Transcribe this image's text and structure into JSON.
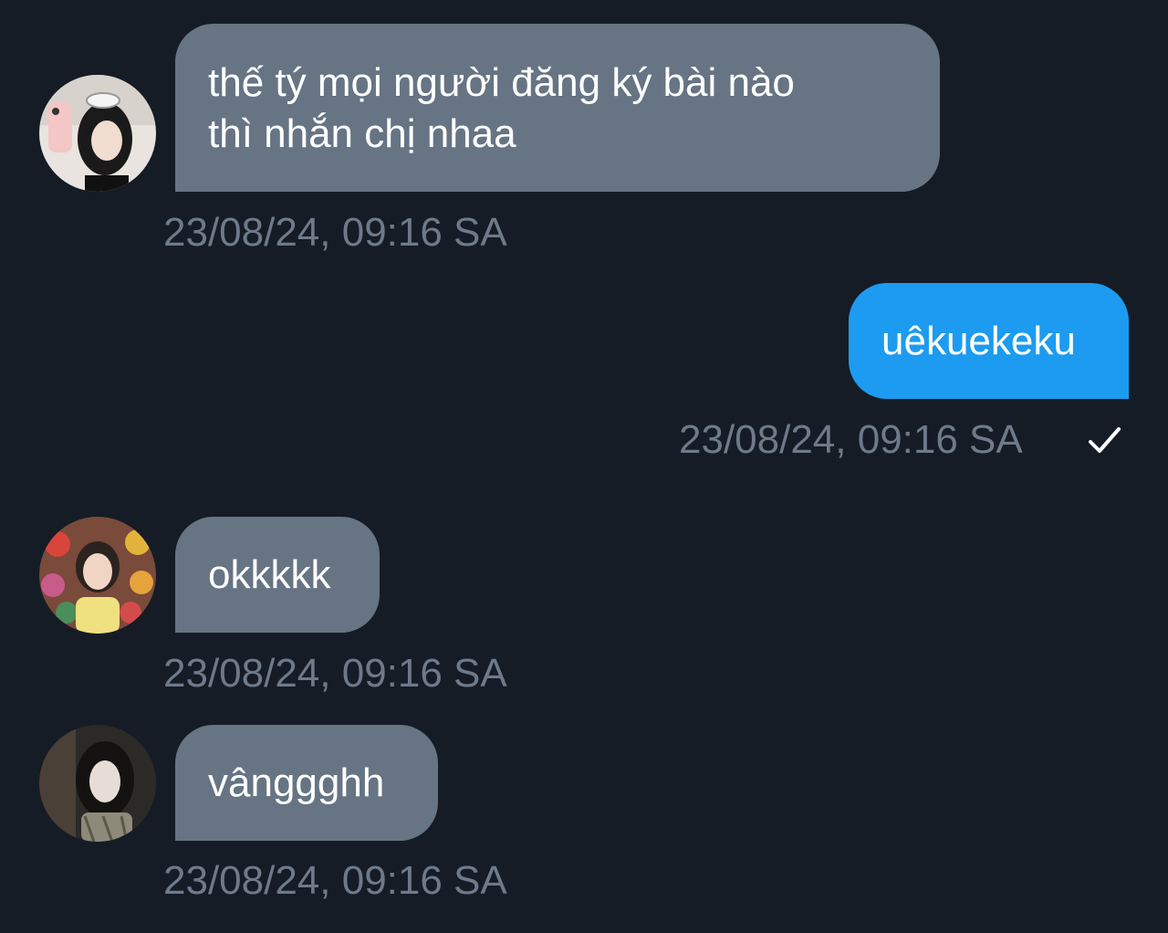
{
  "messages": [
    {
      "direction": "incoming",
      "text_lines": [
        "thế tý mọi người đăng ký bài nào",
        "thì nhắn chị nhaa"
      ],
      "timestamp": "23/08/24, 09:16 SA",
      "avatar": "user-photo-1"
    },
    {
      "direction": "outgoing",
      "text_lines": [
        "uêkuekeku"
      ],
      "timestamp": "23/08/24, 09:16 SA",
      "status_icon": "check-icon"
    },
    {
      "direction": "incoming",
      "text_lines": [
        "okkkkk"
      ],
      "timestamp": "23/08/24, 09:16 SA",
      "avatar": "user-photo-2"
    },
    {
      "direction": "incoming",
      "text_lines": [
        "vânggghh"
      ],
      "timestamp": "23/08/24, 09:16 SA",
      "avatar": "user-photo-3"
    }
  ],
  "colors": {
    "background": "#151c26",
    "incoming_bubble": "#667484",
    "outgoing_bubble": "#1d9bf0",
    "timestamp": "#6e7a89"
  }
}
